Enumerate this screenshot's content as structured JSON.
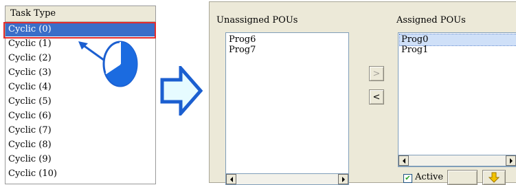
{
  "task_list": {
    "header": "Task Type",
    "items": [
      "Cyclic (0)",
      "Cyclic (1)",
      "Cyclic (2)",
      "Cyclic (3)",
      "Cyclic (4)",
      "Cyclic (5)",
      "Cyclic (6)",
      "Cyclic (7)",
      "Cyclic (8)",
      "Cyclic (9)",
      "Cyclic (10)"
    ],
    "selected_index": 0
  },
  "dialog": {
    "unassigned_label": "Unassigned POUs",
    "unassigned_items": [
      "Prog6",
      "Prog7"
    ],
    "assigned_label": "Assigned POUs",
    "assigned_items": [
      "Prog0",
      "Prog1"
    ],
    "assign_button": ">",
    "unassign_button": "<",
    "active_label": "Active",
    "active_checked": true
  },
  "colors": {
    "selection": "#3a6ec9",
    "highlight_outline": "#e32b2b",
    "arrow_fill": "#e6fbff",
    "arrow_stroke": "#1b5fd0"
  },
  "icons": [
    "pie-clock-icon",
    "pointer-arrow-icon",
    "right-arrow-icon",
    "down-arrow-icon",
    "check-icon"
  ]
}
